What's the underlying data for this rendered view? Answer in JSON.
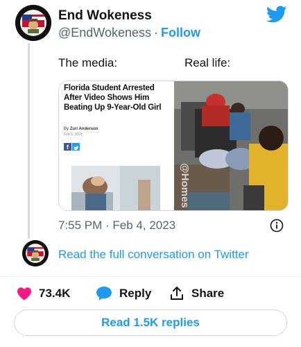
{
  "author": {
    "name": "End Wokeness",
    "handle": "@EndWokeness",
    "separator": "·",
    "follow_label": "Follow",
    "avatar_text": "I SUPPORT THE BORDER PATROL"
  },
  "tweet": {
    "caption_left": "The media:",
    "caption_right": "Real life:",
    "timestamp": "7:55 PM · Feb 4, 2023"
  },
  "article": {
    "title": "Florida Student Arrested After Video Shows Him Beating Up 9-Year-Old Girl",
    "byline_prefix": "By",
    "author": "Zuri Anderson",
    "date": "Feb 3, 2023",
    "fb_letter": "f"
  },
  "video": {
    "watermark": "@Homes"
  },
  "conversation": {
    "read_link": "Read the full conversation on Twitter"
  },
  "actions": {
    "likes": "73.4K",
    "reply_label": "Reply",
    "share_label": "Share"
  },
  "replies_button": "Read 1.5K replies",
  "colors": {
    "accent": "#1d9bf0",
    "like": "#f91880",
    "text": "#0f1419",
    "muted": "#536471"
  }
}
